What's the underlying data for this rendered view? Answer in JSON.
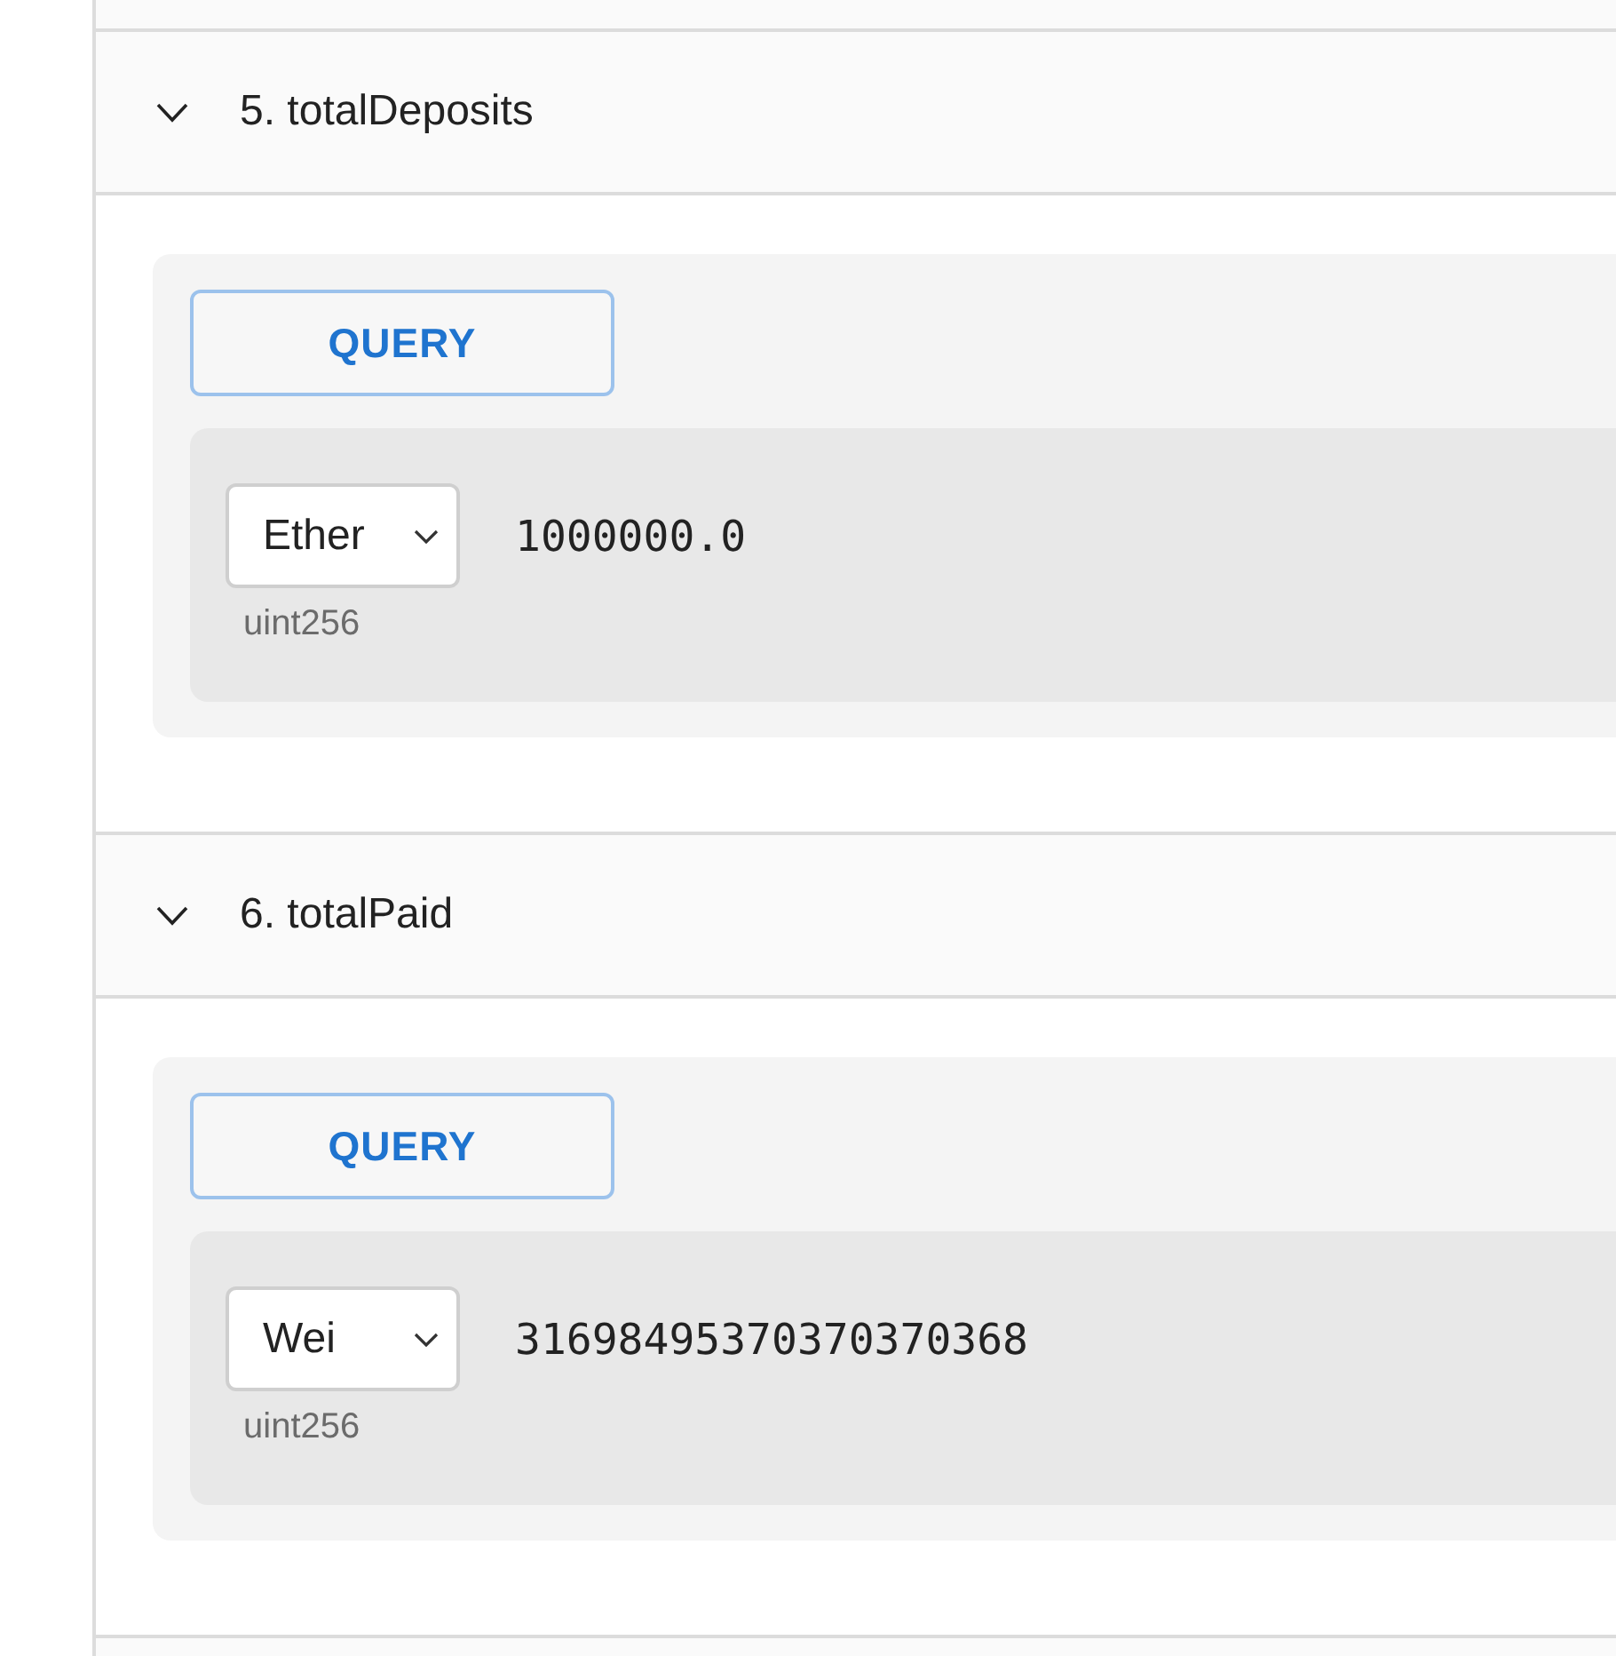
{
  "sections": [
    {
      "title": "5. totalDeposits",
      "expanded": true,
      "query_button": "QUERY",
      "results": [
        {
          "unit": "Ether",
          "value": "1000000.0",
          "type": "uint256"
        }
      ]
    },
    {
      "title": "6. totalPaid",
      "expanded": true,
      "query_button": "QUERY",
      "results": [
        {
          "unit": "Wei",
          "value": "31698495370370370368",
          "type": "uint256"
        }
      ]
    }
  ]
}
